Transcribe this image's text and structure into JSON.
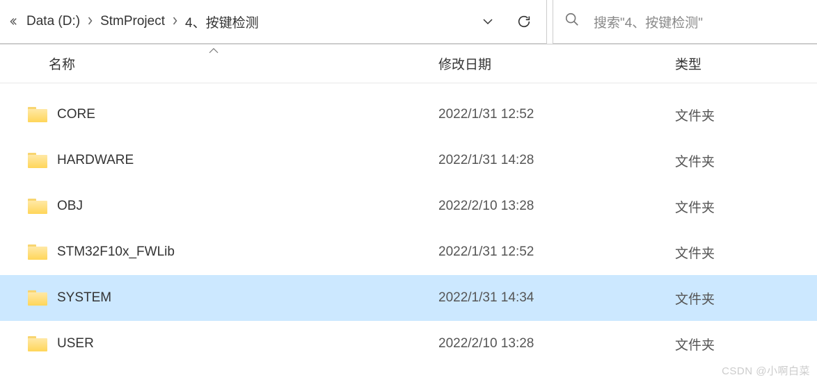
{
  "breadcrumb": {
    "items": [
      {
        "label": "Data (D:)"
      },
      {
        "label": "StmProject"
      },
      {
        "label": "4、按键检测"
      }
    ]
  },
  "search": {
    "placeholder": "搜索\"4、按键检测\""
  },
  "columns": {
    "name": "名称",
    "modified": "修改日期",
    "type": "类型"
  },
  "rows": [
    {
      "name": "CORE",
      "modified": "2022/1/31 12:52",
      "type": "文件夹",
      "selected": false
    },
    {
      "name": "HARDWARE",
      "modified": "2022/1/31 14:28",
      "type": "文件夹",
      "selected": false
    },
    {
      "name": "OBJ",
      "modified": "2022/2/10 13:28",
      "type": "文件夹",
      "selected": false
    },
    {
      "name": "STM32F10x_FWLib",
      "modified": "2022/1/31 12:52",
      "type": "文件夹",
      "selected": false
    },
    {
      "name": "SYSTEM",
      "modified": "2022/1/31 14:34",
      "type": "文件夹",
      "selected": true
    },
    {
      "name": "USER",
      "modified": "2022/2/10 13:28",
      "type": "文件夹",
      "selected": false
    }
  ],
  "watermark": "CSDN @小啊白菜"
}
